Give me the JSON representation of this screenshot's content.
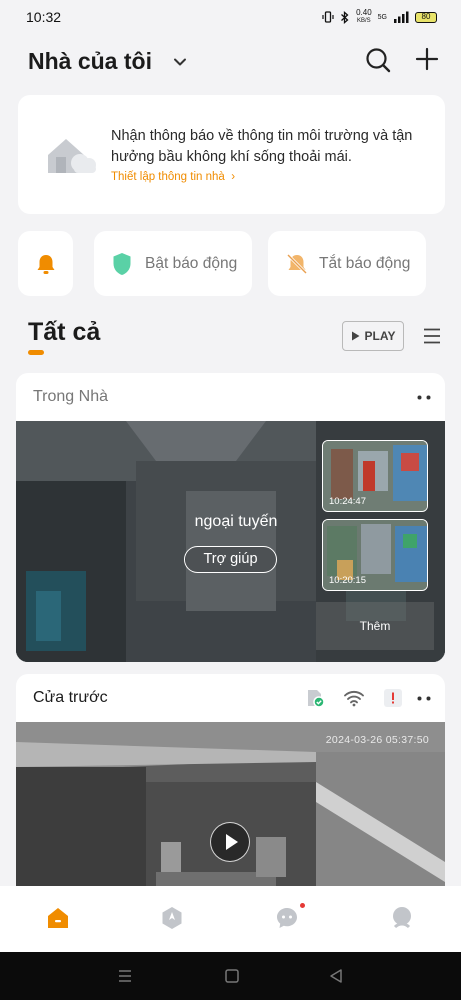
{
  "status_bar": {
    "time": "10:32",
    "speed_value": "0.40",
    "speed_unit": "KB/S",
    "network": "5G",
    "battery": "80"
  },
  "header": {
    "home_name": "Nhà của tôi",
    "chevron_icon": "chevron-down-icon",
    "search_icon": "search-icon",
    "add_icon": "plus-icon"
  },
  "notice": {
    "text": "Nhận thông báo về thông tin môi trường và tận hưởng bầu không khí sống thoải mái.",
    "link": "Thiết lập thông tin nhà",
    "link_arrow": "›"
  },
  "quick_actions": {
    "bell_icon": "bell-icon",
    "arm_label": "Bật báo động",
    "disarm_label": "Tắt báo động"
  },
  "section": {
    "title": "Tất cả",
    "play_label": "PLAY",
    "menu_icon": "hamburger-icon"
  },
  "cameras": [
    {
      "name": "Trong Nhà",
      "status": "ngoại tuyến",
      "help_label": "Trợ giúp",
      "thumbnails": [
        {
          "time": "10:24:47"
        },
        {
          "time": "10:20:15"
        }
      ],
      "more_label": "Thêm"
    },
    {
      "name": "Cửa trước",
      "timestamp": "2024-03-26 05:37:50"
    }
  ],
  "tabs": [
    {
      "icon": "home-icon",
      "active": true
    },
    {
      "icon": "compass-icon",
      "active": false
    },
    {
      "icon": "chat-icon",
      "active": false
    },
    {
      "icon": "profile-icon",
      "active": false
    }
  ],
  "colors": {
    "accent": "#f08c00",
    "arm_shield": "#5ad1a6",
    "disarm_bell": "#f2b56a",
    "background": "#f3f3f5"
  }
}
